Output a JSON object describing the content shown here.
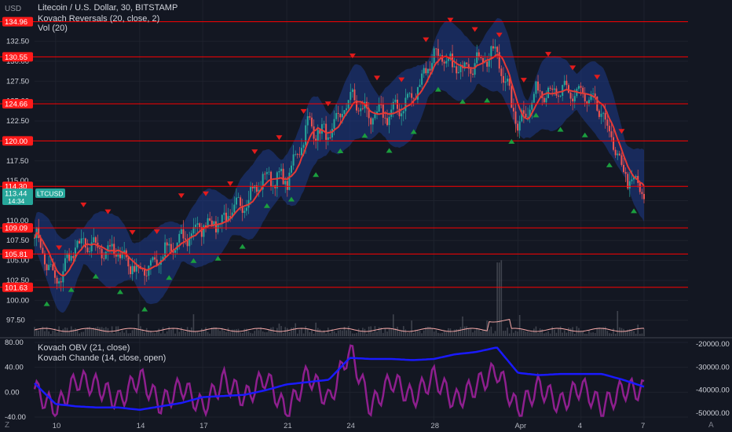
{
  "header": {
    "unit": "USD",
    "symbol_title": "Litecoin / U.S. Dollar, 30, BITSTAMP",
    "indicator_1": "Kovach Reversals (20, close, 2)",
    "indicator_2": "Vol (20)",
    "lower_indicator_1": "Kovach OBV (21, close)",
    "lower_indicator_2": "Kovach Chande (14, close, open)"
  },
  "footer": {
    "left_badge": "Z",
    "right_badge": "A"
  },
  "colors": {
    "background": "#131722",
    "candle_up": "#26a69a",
    "candle_down": "#ef5350",
    "band_fill": "#1e3a8a",
    "basis_line": "#e53935",
    "level_line": "#ff0000",
    "level_tag": "#ff1a1a",
    "price_tag": "#26a69a",
    "up_marker": "#1b9e3e",
    "down_marker": "#e31b1b",
    "obv_line": "#1a1aff",
    "chande_line": "#8e1f8e",
    "volume_ma": "#f7a9a8"
  },
  "chart_data": [
    {
      "type": "candlestick",
      "name": "price",
      "x": [
        "Mar 9 18:00",
        "Mar 10",
        "Mar 11",
        "Mar 12",
        "Mar 13",
        "Mar 14",
        "Mar 15",
        "Mar 16",
        "Mar 17",
        "Mar 18",
        "Mar 19",
        "Mar 20",
        "Mar 21",
        "Mar 22",
        "Mar 23",
        "Mar 24",
        "Mar 25",
        "Mar 26",
        "Mar 27",
        "Mar 28",
        "Mar 29",
        "Mar 30",
        "Mar 31",
        "Apr 1",
        "Apr 2",
        "Apr 3",
        "Apr 4",
        "Apr 5",
        "Apr 6",
        "Apr 7 12:00"
      ],
      "close": [
        108.5,
        102.0,
        107.0,
        106.5,
        106.0,
        103.5,
        105.5,
        107.5,
        109.5,
        110.0,
        112.5,
        115.5,
        115.0,
        122.0,
        120.5,
        125.5,
        123.0,
        123.5,
        125.5,
        131.0,
        129.0,
        130.0,
        131.0,
        122.0,
        126.5,
        126.0,
        126.0,
        123.5,
        116.0,
        113.4
      ],
      "y_ticks": [
        97.5,
        100.0,
        102.5,
        105.0,
        107.5,
        110.0,
        112.5,
        115.0,
        117.5,
        120.0,
        122.5,
        125.0,
        127.5,
        130.0,
        132.5
      ],
      "ylim": [
        95.5,
        136.5
      ],
      "x_tick_labels": [
        "10",
        "14",
        "17",
        "21",
        "24",
        "28",
        "Apr",
        "4",
        "7"
      ],
      "x_tick_index": [
        1,
        5,
        8,
        12,
        15,
        19,
        23,
        26,
        29
      ]
    },
    {
      "type": "horizontal-lines",
      "name": "levels",
      "values": [
        134.96,
        130.55,
        124.66,
        120.0,
        114.3,
        109.09,
        105.81,
        101.63
      ],
      "labels": [
        "134.96",
        "130.55",
        "124.66",
        "120.00",
        "114.30",
        "109.09",
        "105.81",
        "101.63"
      ]
    },
    {
      "type": "price-tag",
      "value": 113.44,
      "label": "113.44",
      "symbol": "LTCUSD",
      "countdown": "14:34"
    },
    {
      "type": "line",
      "name": "oscillators",
      "left_axis_ticks": [
        80.0,
        40.0,
        0.0,
        -40.0
      ],
      "left_axis_labels": [
        "80.00",
        "40.00",
        "0.00",
        "-40.00"
      ],
      "left_ylim": [
        -45,
        85
      ],
      "right_axis_ticks": [
        -20000,
        -30000,
        -40000,
        -50000
      ],
      "right_axis_labels": [
        "-20000.00",
        "-30000.00",
        "-40000.00",
        "-50000.00"
      ],
      "right_ylim": [
        -53000,
        -18000
      ],
      "series": [
        {
          "name": "Kovach OBV (21, close)",
          "axis": "right",
          "values": [
            -37000,
            -46000,
            -47000,
            -47500,
            -47500,
            -48500,
            -47000,
            -45500,
            -43000,
            -42500,
            -42000,
            -40000,
            -37500,
            -36500,
            -35500,
            -26000,
            -26500,
            -26500,
            -27000,
            -26500,
            -24500,
            -23500,
            -21500,
            -32500,
            -33500,
            -33000,
            -33000,
            -33000,
            -35500,
            -38500
          ]
        },
        {
          "name": "Kovach Chande (14, close, open)",
          "axis": "left",
          "values": [
            5,
            -30,
            20,
            10,
            -15,
            25,
            -20,
            10,
            -25,
            20,
            -10,
            25,
            -35,
            30,
            -15,
            70,
            -25,
            20,
            -10,
            25,
            -15,
            10,
            35,
            -30,
            10,
            -20,
            10,
            -25,
            5,
            3
          ]
        }
      ]
    }
  ]
}
